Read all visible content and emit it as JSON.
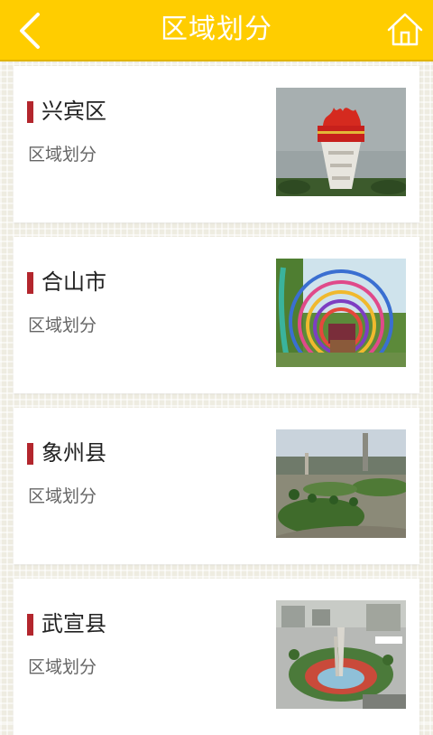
{
  "header": {
    "title": "区域划分",
    "back_icon": "back-chevron-icon",
    "home_icon": "home-icon",
    "background_color": "#ffcd00"
  },
  "regions": [
    {
      "name": "兴宾区",
      "subtitle": "区域划分",
      "image": "monument-photo"
    },
    {
      "name": "合山市",
      "subtitle": "区域划分",
      "image": "flower-arches-photo"
    },
    {
      "name": "象州县",
      "subtitle": "区域划分",
      "image": "town-plaza-photo"
    },
    {
      "name": "武宣县",
      "subtitle": "区域划分",
      "image": "city-fountain-photo"
    }
  ],
  "accent_color": "#b3262d"
}
